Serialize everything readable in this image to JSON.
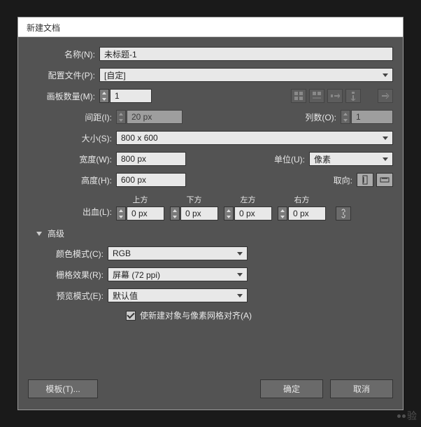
{
  "title": "新建文档",
  "labels": {
    "name": "名称(N):",
    "profile": "配置文件(P):",
    "artboards": "画板数量(M):",
    "spacing": "间距(I):",
    "columns": "列数(O):",
    "size": "大小(S):",
    "width": "宽度(W):",
    "units": "单位(U):",
    "height": "高度(H):",
    "orientation": "取向:",
    "bleed": "出血(L):",
    "advanced": "高级",
    "colorMode": "颜色模式(C):",
    "raster": "栅格效果(R):",
    "preview": "预览模式(E):",
    "align": "使新建对象与像素网格对齐(A)",
    "templates": "模板(T)...",
    "ok": "确定",
    "cancel": "取消"
  },
  "values": {
    "name": "未标题-1",
    "profile": "[自定]",
    "artboards": "1",
    "spacing": "20 px",
    "columns": "1",
    "size": "800 x 600",
    "width": "800 px",
    "height": "600 px",
    "units": "像素",
    "colorMode": "RGB",
    "raster": "屏幕 (72 ppi)",
    "preview": "默认值"
  },
  "bleed": {
    "top": {
      "hdr": "上方",
      "val": "0 px"
    },
    "bottom": {
      "hdr": "下方",
      "val": "0 px"
    },
    "left": {
      "hdr": "左方",
      "val": "0 px"
    },
    "right": {
      "hdr": "右方",
      "val": "0 px"
    }
  },
  "watermark": "验"
}
